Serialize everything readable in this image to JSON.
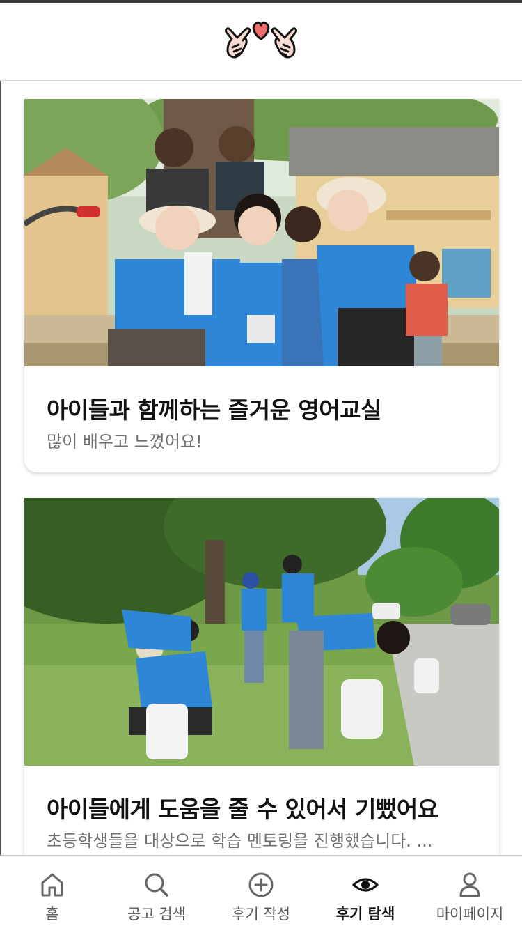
{
  "header": {
    "logo_icon": "pinky-promise-heart-icon"
  },
  "posts": [
    {
      "title": "아이들과 함께하는 즐거운 영어교실",
      "subtitle": "많이 배우고 느꼈어요!",
      "image": "photo-volunteers-with-children-heart-gesture"
    },
    {
      "title": "아이들에게 도움을 줄 수 있어서 기뻤어요",
      "subtitle": "초등학생들을 대상으로 학습 멘토링을 진행했습니다. ...",
      "image": "photo-volunteers-picking-up-trash-in-park"
    }
  ],
  "nav": {
    "items": [
      {
        "label": "홈",
        "icon": "home-icon"
      },
      {
        "label": "공고 검색",
        "icon": "search-icon"
      },
      {
        "label": "후기 작성",
        "icon": "plus-circle-icon"
      },
      {
        "label": "후기 탐색",
        "icon": "eye-icon",
        "active": true
      },
      {
        "label": "마이페이지",
        "icon": "user-icon"
      }
    ]
  },
  "colors": {
    "accent_heart": "#f26b6b",
    "vest_blue": "#2e86d6",
    "title_text": "#111111",
    "subtitle_text": "#6f6f6f"
  }
}
